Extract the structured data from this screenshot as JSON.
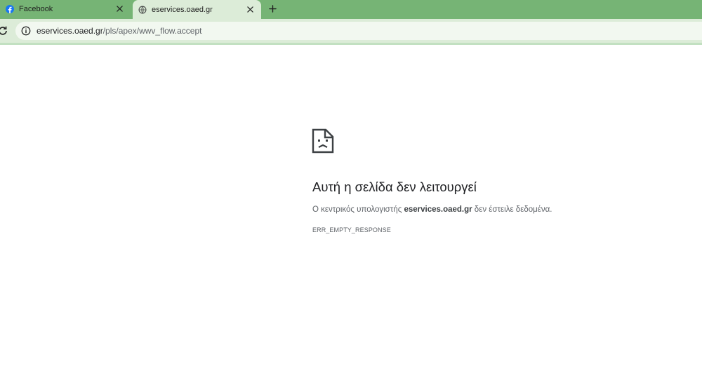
{
  "tabs": [
    {
      "title": "Facebook",
      "favicon": "facebook-icon",
      "active": false
    },
    {
      "title": "eservices.oaed.gr",
      "favicon": "globe-icon",
      "active": true
    }
  ],
  "toolbar": {
    "url_host": "eservices.oaed.gr",
    "url_path": "/pls/apex/wwv_flow.accept"
  },
  "error": {
    "title": "Αυτή η σελίδα δεν λειτουργεί",
    "desc_before": "Ο κεντρικός υπολογιστής ",
    "desc_host": "eservices.oaed.gr",
    "desc_after": " δεν έστειλε δεδομένα.",
    "code": "ERR_EMPTY_RESPONSE"
  },
  "colors": {
    "tabstrip": "#76b475",
    "toolbar": "#dcecd8",
    "facebook": "#1877f2"
  }
}
